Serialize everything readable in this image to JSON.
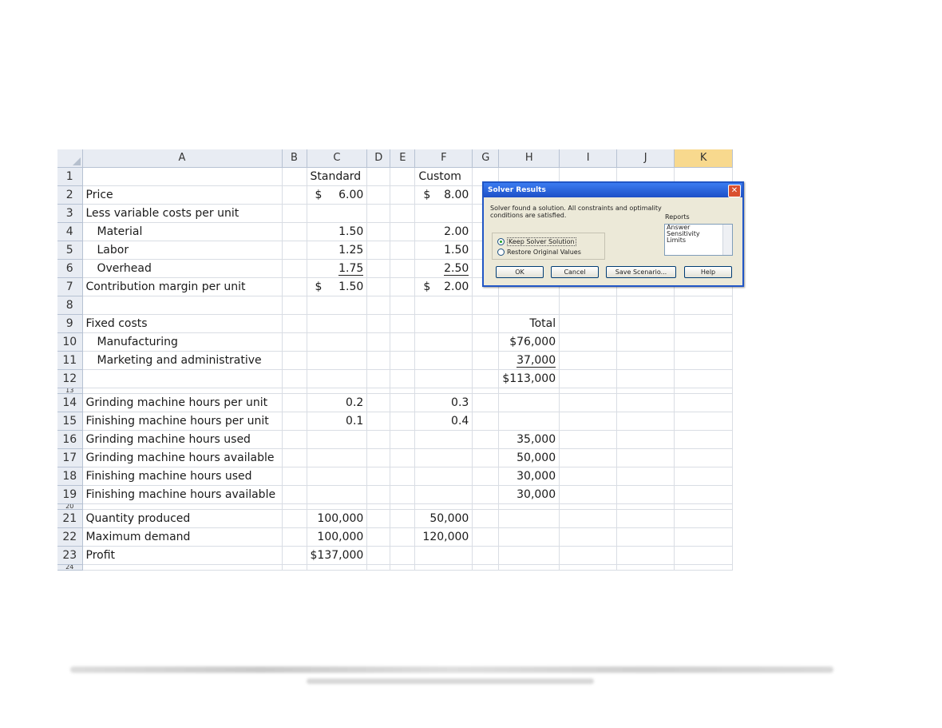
{
  "columns": [
    "A",
    "B",
    "C",
    "D",
    "E",
    "F",
    "G",
    "H",
    "I",
    "J",
    "K"
  ],
  "selected_column": "K",
  "rows": [
    {
      "n": "1",
      "a": "",
      "c": "Standard",
      "f": "Custom",
      "h": ""
    },
    {
      "n": "2",
      "a": "Price",
      "c_dol": "$",
      "c": "6.00",
      "f_dol": "$",
      "f": "8.00"
    },
    {
      "n": "3",
      "a": "Less variable costs per unit"
    },
    {
      "n": "4",
      "a": "Material",
      "c": "1.50",
      "f": "2.00"
    },
    {
      "n": "5",
      "a": "Labor",
      "c": "1.25",
      "f": "1.50"
    },
    {
      "n": "6",
      "a": "Overhead",
      "c": "1.75",
      "f": "2.50"
    },
    {
      "n": "7",
      "a": "Contribution margin per unit",
      "c_dol": "$",
      "c": "1.50",
      "f_dol": "$",
      "f": "2.00"
    },
    {
      "n": "8",
      "a": ""
    },
    {
      "n": "9",
      "a": "Fixed costs",
      "h": "Total"
    },
    {
      "n": "10",
      "a": "Manufacturing",
      "h": "$76,000"
    },
    {
      "n": "11",
      "a": "Marketing and administrative",
      "h": "37,000"
    },
    {
      "n": "12",
      "a": "",
      "h": "$113,000"
    },
    {
      "n": "13",
      "a": ""
    },
    {
      "n": "14",
      "a": "Grinding machine hours per unit",
      "c": "0.2",
      "f": "0.3"
    },
    {
      "n": "15",
      "a": "Finishing machine hours per unit",
      "c": "0.1",
      "f": "0.4"
    },
    {
      "n": "16",
      "a": "Grinding machine hours used",
      "h": "35,000"
    },
    {
      "n": "17",
      "a": "Grinding machine hours available",
      "h": "50,000"
    },
    {
      "n": "18",
      "a": "Finishing machine hours used",
      "h": "30,000"
    },
    {
      "n": "19",
      "a": "Finishing machine hours available",
      "h": "30,000"
    },
    {
      "n": "20",
      "a": ""
    },
    {
      "n": "21",
      "a": "Quantity produced",
      "c": "100,000",
      "f": "50,000"
    },
    {
      "n": "22",
      "a": "Maximum demand",
      "c": "100,000",
      "f": "120,000"
    },
    {
      "n": "23",
      "a": "Profit",
      "c": "$137,000"
    },
    {
      "n": "24",
      "a": ""
    }
  ],
  "solver": {
    "title": "Solver Results",
    "close_icon": "close-icon",
    "message": "Solver found a solution.  All constraints and optimality conditions are satisfied.",
    "reports_label": "Reports",
    "reports": [
      "Answer",
      "Sensitivity",
      "Limits"
    ],
    "option_keep": "Keep Solver Solution",
    "option_restore": "Restore Original Values",
    "ok": "OK",
    "cancel": "Cancel",
    "save_scenario": "Save Scenario...",
    "help": "Help"
  }
}
